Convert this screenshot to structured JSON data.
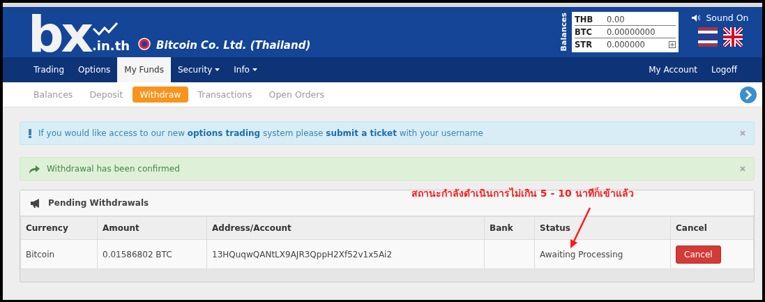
{
  "logo": {
    "mark": "bx",
    "domain": ".in.th",
    "company": "Bitcoin Co. Ltd. (Thailand)"
  },
  "balances": {
    "label": "Balances",
    "rows": [
      {
        "currency": "THB",
        "amount": "0.00"
      },
      {
        "currency": "BTC",
        "amount": "0.00000000"
      },
      {
        "currency": "STR",
        "amount": "0.000000"
      }
    ]
  },
  "sound": {
    "label": "Sound On"
  },
  "nav": {
    "items": [
      {
        "label": "Trading",
        "selected": false,
        "dropdown": false
      },
      {
        "label": "Options",
        "selected": false,
        "dropdown": false
      },
      {
        "label": "My Funds",
        "selected": true,
        "dropdown": false
      },
      {
        "label": "Security",
        "selected": false,
        "dropdown": true
      },
      {
        "label": "Info",
        "selected": false,
        "dropdown": true
      }
    ],
    "right": [
      "My Account",
      "Logoff"
    ]
  },
  "subnav": [
    {
      "label": "Balances",
      "selected": false
    },
    {
      "label": "Deposit",
      "selected": false
    },
    {
      "label": "Withdraw",
      "selected": true
    },
    {
      "label": "Transactions",
      "selected": false
    },
    {
      "label": "Open Orders",
      "selected": false
    }
  ],
  "alerts": [
    {
      "kind": "info",
      "text": "If you would like access to our new **options trading** system please **submit a ticket** with your username"
    },
    {
      "kind": "success",
      "text": "Withdrawal has been confirmed"
    }
  ],
  "annotation": "สถานะกำลังดำเนินการไม่เกิน 5 - 10 นาทีก็เข้าแล้ว",
  "panel": {
    "title": "Pending Withdrawals",
    "columns": [
      "Currency",
      "Amount",
      "Address/Account",
      "Bank",
      "Status",
      "Cancel"
    ],
    "rows": [
      {
        "currency": "Bitcoin",
        "amount": "0.01586802 BTC",
        "address": "13HQuqwQANtLX9AJR3QppH2Xf52v1x5Ai2",
        "bank": "",
        "status": "Awaiting Processing",
        "action": "Cancel"
      }
    ]
  }
}
